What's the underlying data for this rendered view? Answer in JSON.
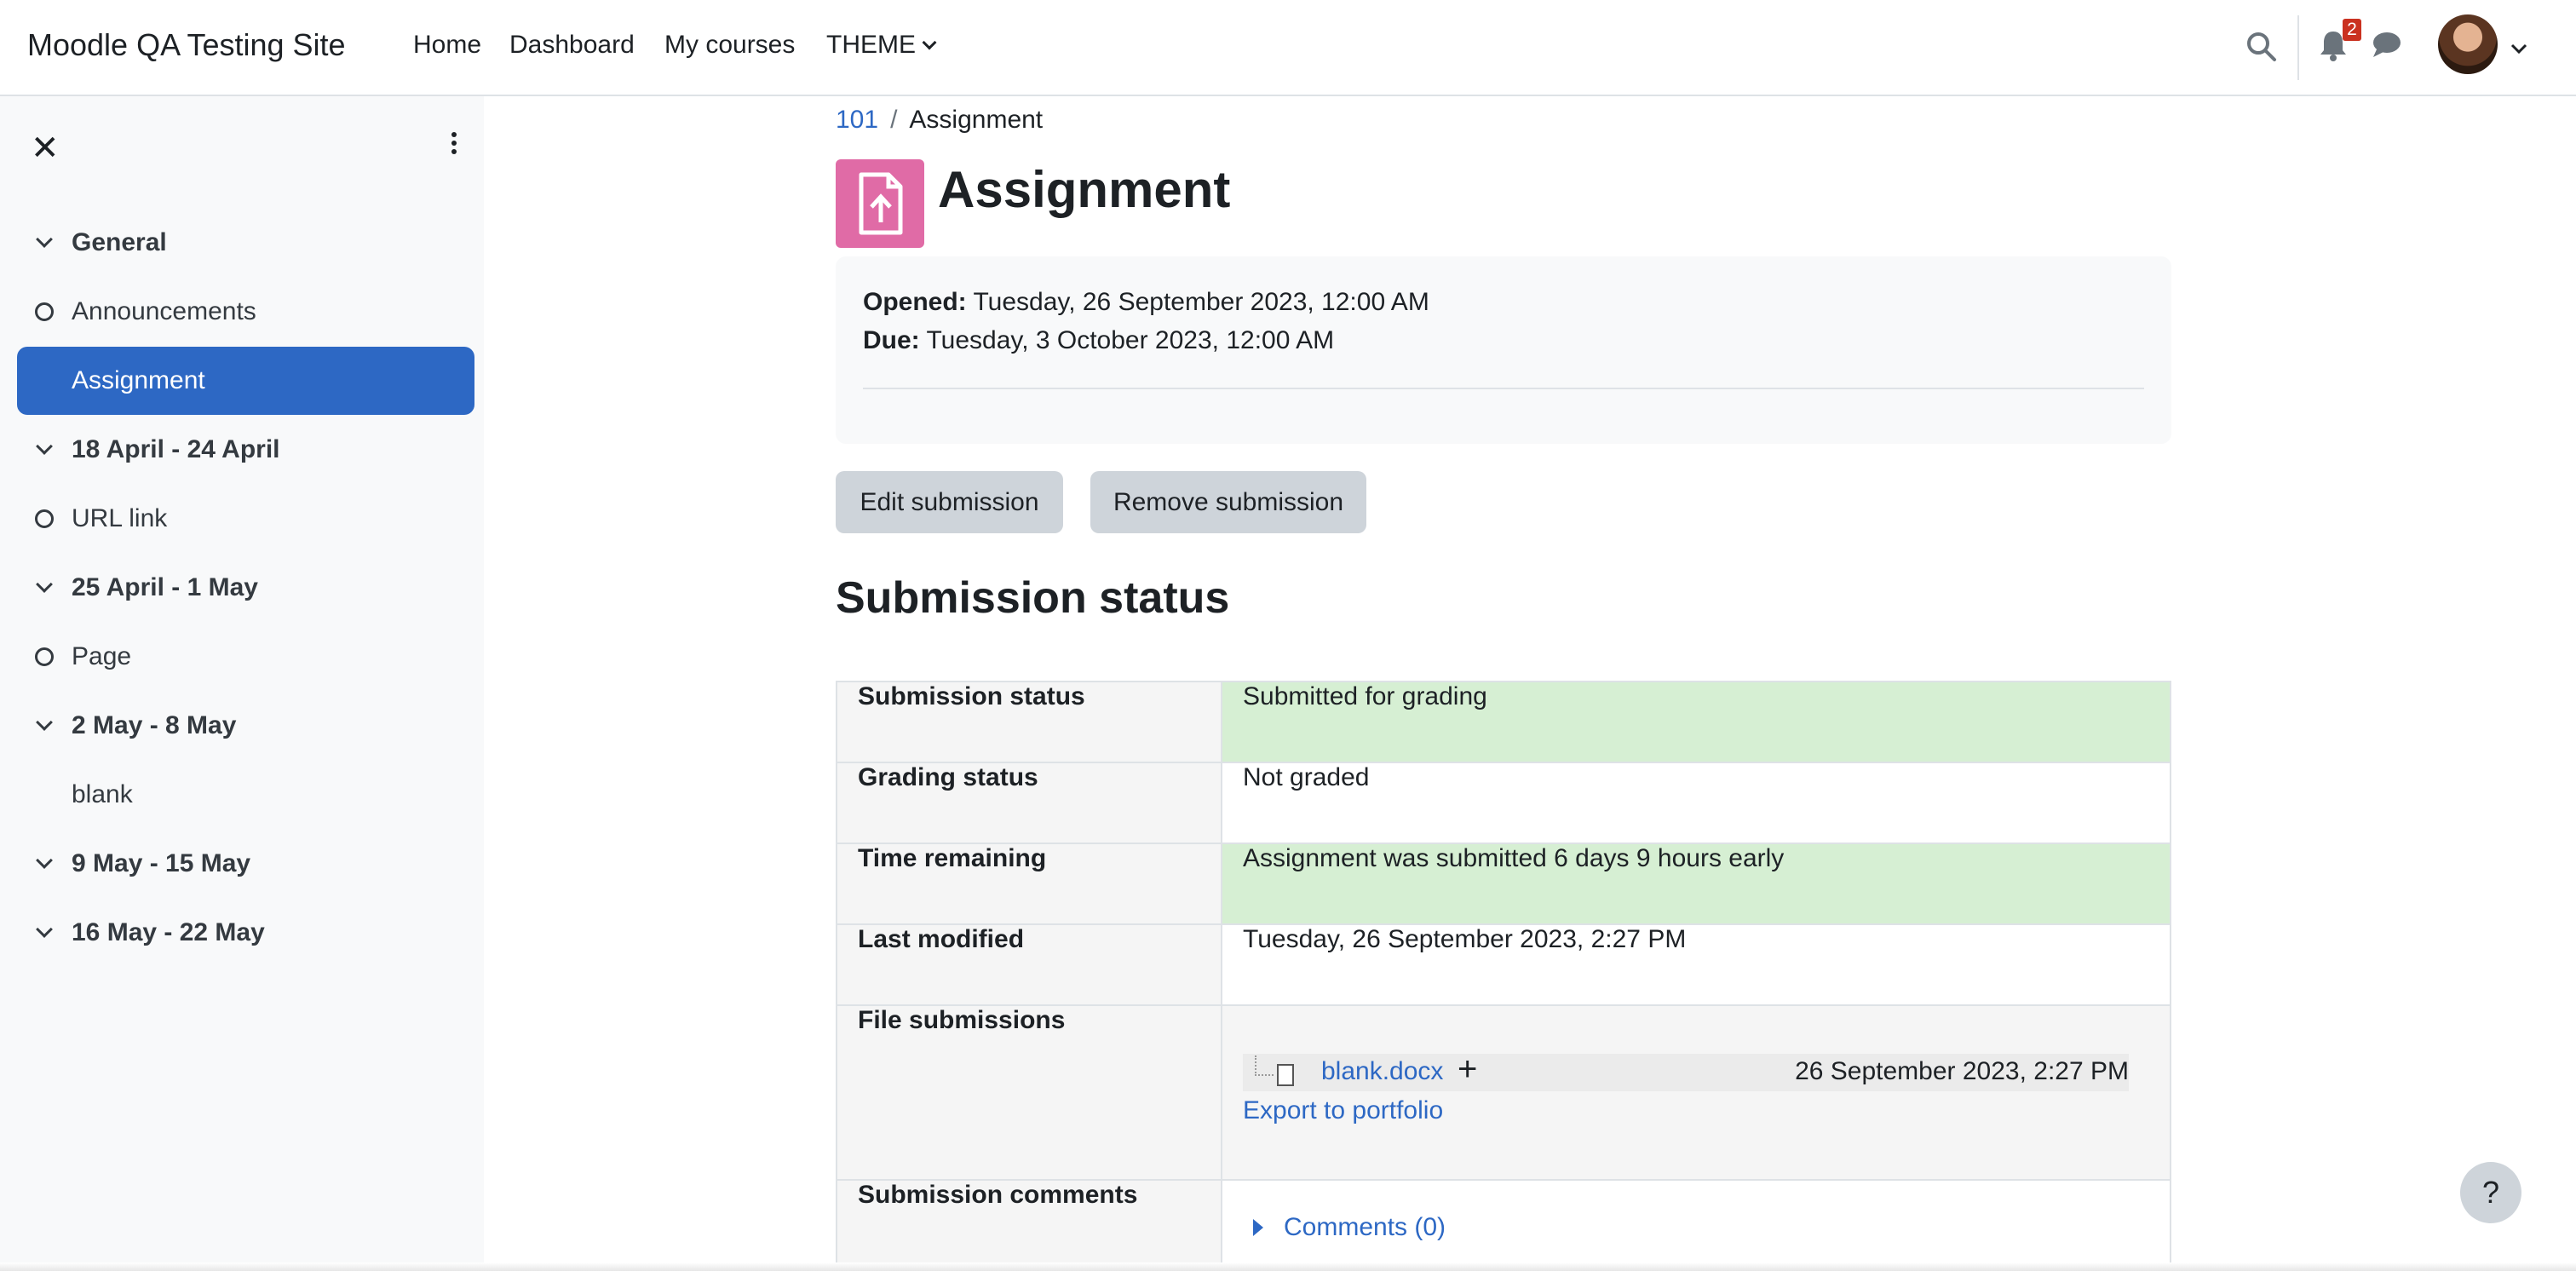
{
  "navbar": {
    "brand": "Moodle QA Testing Site",
    "links": [
      "Home",
      "Dashboard",
      "My courses",
      "THEME"
    ],
    "notification_count": "2",
    "icons": [
      "search-icon",
      "bell-icon",
      "chat-icon",
      "avatar",
      "chevron-down-icon"
    ]
  },
  "drawer": {
    "items": [
      {
        "type": "section",
        "label": "General"
      },
      {
        "type": "activity",
        "label": "Announcements"
      },
      {
        "type": "activity",
        "label": "Assignment",
        "active": true
      },
      {
        "type": "section",
        "label": "18 April - 24 April"
      },
      {
        "type": "activity",
        "label": "URL link"
      },
      {
        "type": "section",
        "label": "25 April - 1 May"
      },
      {
        "type": "activity",
        "label": "Page"
      },
      {
        "type": "section",
        "label": "2 May - 8 May"
      },
      {
        "type": "activity",
        "label": "blank"
      },
      {
        "type": "section",
        "label": "9 May - 15 May"
      },
      {
        "type": "section",
        "label": "16 May - 22 May"
      }
    ]
  },
  "breadcrumb": {
    "course": "101",
    "sep": "/",
    "current": "Assignment"
  },
  "page": {
    "title": "Assignment",
    "opened_label": "Opened:",
    "opened_value": "Tuesday, 26 September 2023, 12:00 AM",
    "due_label": "Due:",
    "due_value": "Tuesday, 3 October 2023, 12:00 AM"
  },
  "buttons": {
    "edit": "Edit submission",
    "remove": "Remove submission"
  },
  "submission": {
    "heading": "Submission status",
    "rows": [
      {
        "label": "Submission status",
        "value": "Submitted for grading"
      },
      {
        "label": "Grading status",
        "value": "Not graded"
      },
      {
        "label": "Time remaining",
        "value": "Assignment was submitted 6 days 9 hours early"
      },
      {
        "label": "Last modified",
        "value": "Tuesday, 26 September 2023, 2:27 PM"
      },
      {
        "label": "File submissions",
        "file_name": "blank.docx",
        "file_date": "26 September 2023, 2:27 PM",
        "export": "Export to portfolio"
      },
      {
        "label": "Submission comments",
        "comments": "Comments (0)"
      }
    ]
  },
  "help": "?",
  "colors": {
    "accent": "#2d68c4",
    "success_bg": "#d6efd3",
    "assignment_icon": "#e06ba6",
    "badge": "#ca3120"
  }
}
